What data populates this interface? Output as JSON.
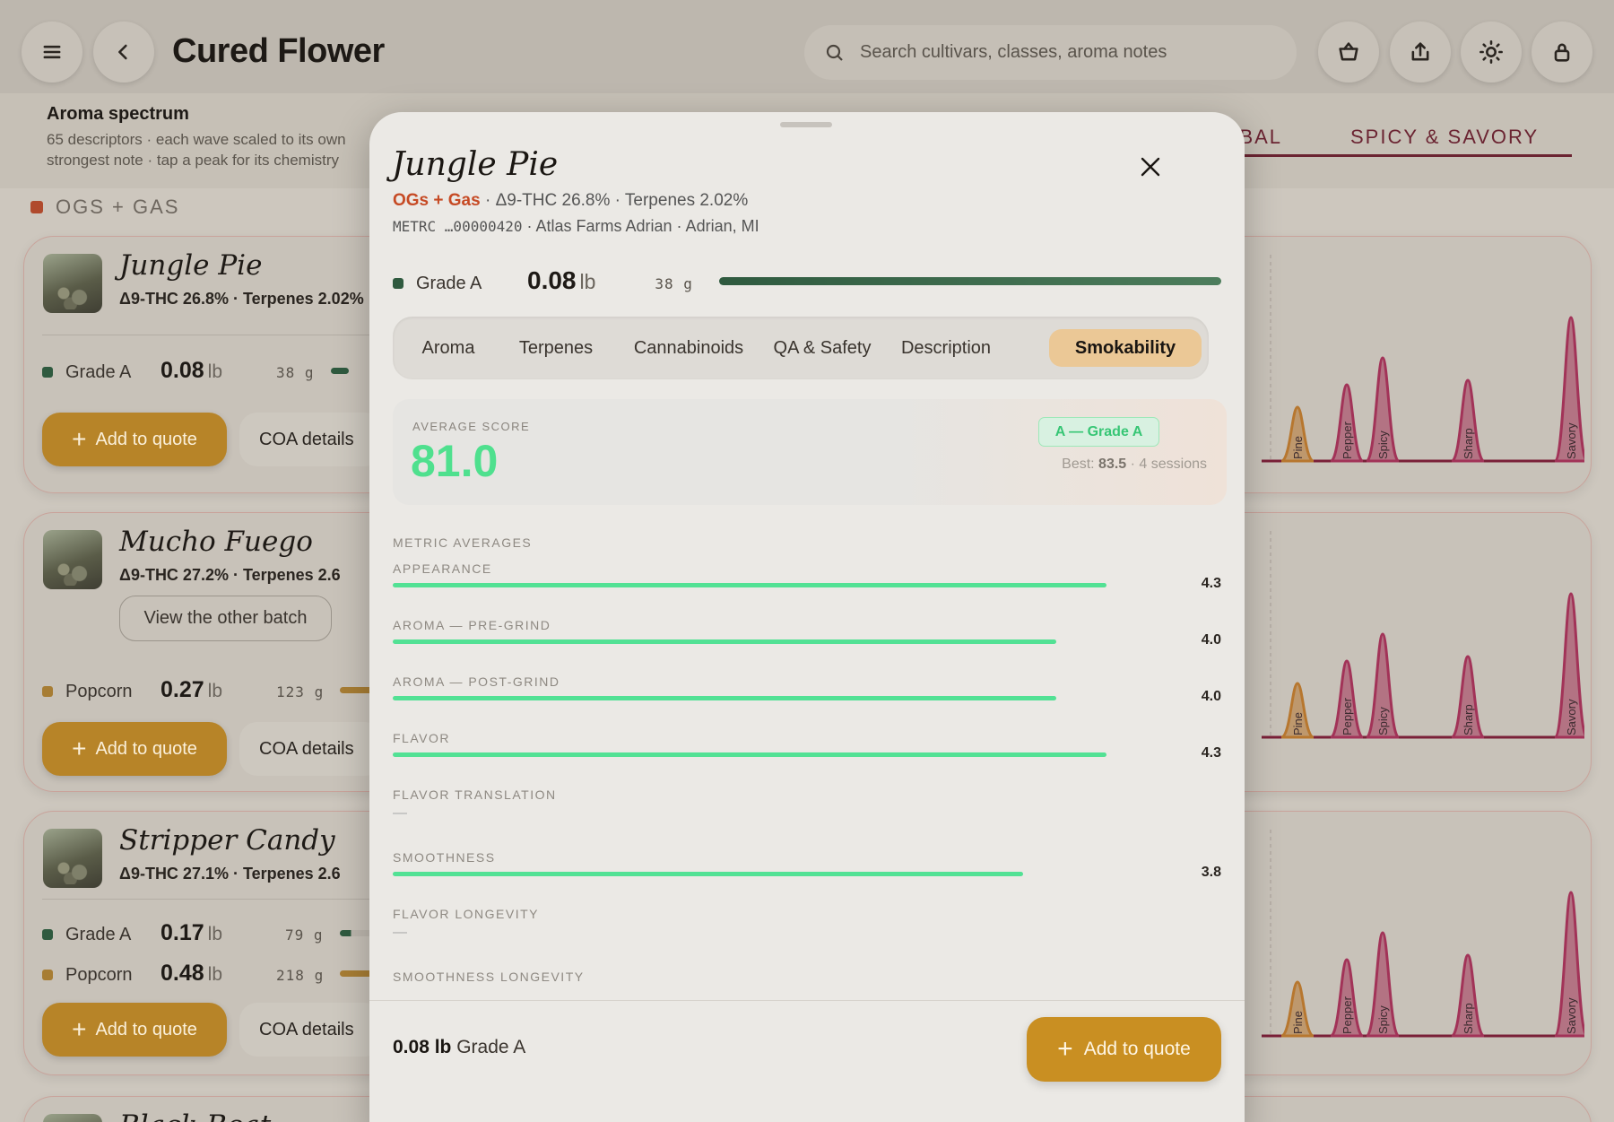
{
  "topbar": {
    "title": "Cured Flower",
    "search_placeholder": "Search cultivars, classes, aroma notes"
  },
  "aroma_band": {
    "title": "Aroma spectrum",
    "description": "65 descriptors · each wave scaled to its own strongest note · tap a peak for its chemistry",
    "tabs": [
      "HERBAL",
      "SPICY & SAVORY"
    ],
    "active_tab": "SPICY & SAVORY"
  },
  "section": {
    "label": "OGS + GAS"
  },
  "cards": [
    {
      "name": "Jungle Pie",
      "meta": "Δ9-THC 26.8%  ·  Terpenes 2.02%",
      "grades": [
        {
          "name": "Grade A",
          "value": "0.08",
          "unit": "lb",
          "grams": "38  g",
          "fill": 0.1
        }
      ],
      "add_label": "Add to quote",
      "coa_label": "COA details"
    },
    {
      "name": "Mucho Fuego",
      "meta": "Δ9-THC 27.2%  ·  Terpenes 2.6",
      "other_batch": "View the other batch",
      "grades": [
        {
          "name": "Popcorn",
          "value": "0.27",
          "unit": "lb",
          "grams": "123  g",
          "fill": 0.32
        }
      ],
      "add_label": "Add to quote",
      "coa_label": "COA details"
    },
    {
      "name": "Stripper Candy",
      "meta": "Δ9-THC 27.1%  ·  Terpenes 2.6",
      "grades": [
        {
          "name": "Grade A",
          "value": "0.17",
          "unit": "lb",
          "grams": "79  g",
          "fill": 0.2
        },
        {
          "name": "Popcorn",
          "value": "0.48",
          "unit": "lb",
          "grams": "218  g",
          "fill": 0.56
        }
      ],
      "add_label": "Add to quote",
      "coa_label": "COA details"
    },
    {
      "name": "Black Beat"
    }
  ],
  "wave_labels": [
    "Pine",
    "Pepper",
    "Spicy",
    "Sharp",
    "Savory"
  ],
  "modal": {
    "title": "Jungle Pie",
    "class": "OGs + Gas",
    "sub": " · Δ9-THC 26.8% · Terpenes 2.02%",
    "metrc_code": "METRC  …00000420",
    "source": " · Atlas Farms Adrian · Adrian, MI",
    "grade": {
      "name": "Grade A",
      "value": "0.08",
      "unit": "lb",
      "grams": "38  g"
    },
    "tabs": [
      "Aroma",
      "Terpenes",
      "Cannabinoids",
      "QA & Safety",
      "Description",
      "Smokability"
    ],
    "active_tab": "Smokability",
    "score": {
      "label": "AVERAGE SCORE",
      "value": "81.0",
      "badge": "A — Grade A",
      "best_prefix": "Best: ",
      "best_value": "83.5",
      "best_suffix": " · 4 sessions"
    },
    "metrics_heading": "METRIC AVERAGES",
    "metrics": [
      {
        "label": "APPEARANCE",
        "value": "4.3",
        "fraction": 0.86
      },
      {
        "label": "AROMA — PRE-GRIND",
        "value": "4.0",
        "fraction": 0.8
      },
      {
        "label": "AROMA — POST-GRIND",
        "value": "4.0",
        "fraction": 0.8
      },
      {
        "label": "FLAVOR",
        "value": "4.3",
        "fraction": 0.86
      },
      {
        "label": "FLAVOR TRANSLATION",
        "value": "—",
        "fraction": null
      },
      {
        "label": "SMOOTHNESS",
        "value": "3.8",
        "fraction": 0.76
      },
      {
        "label": "FLAVOR LONGEVITY",
        "value": "—",
        "fraction": null
      },
      {
        "label": "SMOOTHNESS LONGEVITY",
        "value": "",
        "fraction": null
      }
    ],
    "footer": {
      "amount": "0.08 lb",
      "grade": " Grade A",
      "add_label": "Add to quote"
    }
  },
  "colors": {
    "accent_gold": "#c98f22",
    "grade_a": "#2f5a3f",
    "popcorn": "#a77d34",
    "score_green": "#4fe08e",
    "class_red": "#c64a24",
    "wave": "#7a2038"
  }
}
